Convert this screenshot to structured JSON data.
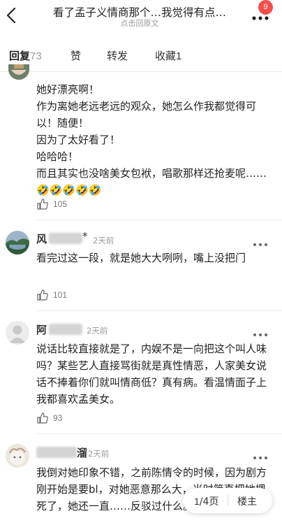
{
  "header": {
    "title": "看了孟子义情商那个…我觉得有点…",
    "subtitle": "点击回原文",
    "badge": "9"
  },
  "tabs": [
    {
      "label": "回复",
      "count": "73",
      "active": true
    },
    {
      "label": "赞",
      "count": ""
    },
    {
      "label": "转发",
      "count": ""
    },
    {
      "label": "收藏",
      "count": "1"
    }
  ],
  "comments": [
    {
      "text": "她好漂亮啊！\n作为离她老远老远的观众，她怎么作我都觉得可以！随便！\n因为了太好看了！\n哈哈哈！\n而且其实也没啥美女包袱，唱歌那样还抢麦呢……🤣🤣🤣🤣🤣",
      "likes": "105"
    },
    {
      "name_visible": "风",
      "name_visible_end": "*",
      "time": "2天前",
      "text": "看完过这一段，就是她大大咧咧，嘴上没把门",
      "likes": "101"
    },
    {
      "name_visible": "阿",
      "time": "2天前",
      "text": "说话比较直接就是了，内娱不是一向把这个叫人味吗？某些艺人直接骂街就是真性情恶，人家美女说话不捧着你们就叫情商低？真有病。看温情面子上我都喜欢孟美女。",
      "likes": "93"
    },
    {
      "name_visible_end": "溜",
      "time": "2天前",
      "text": "我倒对她印象不错，之前陈情令的时候，因为剧方刚开始是要bl，对她恶意那么大，当时简直把她摁死了，她还一直……反驳过什么。"
    }
  ],
  "pager": {
    "current": "1",
    "total": "/4页",
    "op": "楼主"
  },
  "colors": {
    "badge": "#f0504a",
    "text": "#222222",
    "muted": "#9a9a9a"
  }
}
